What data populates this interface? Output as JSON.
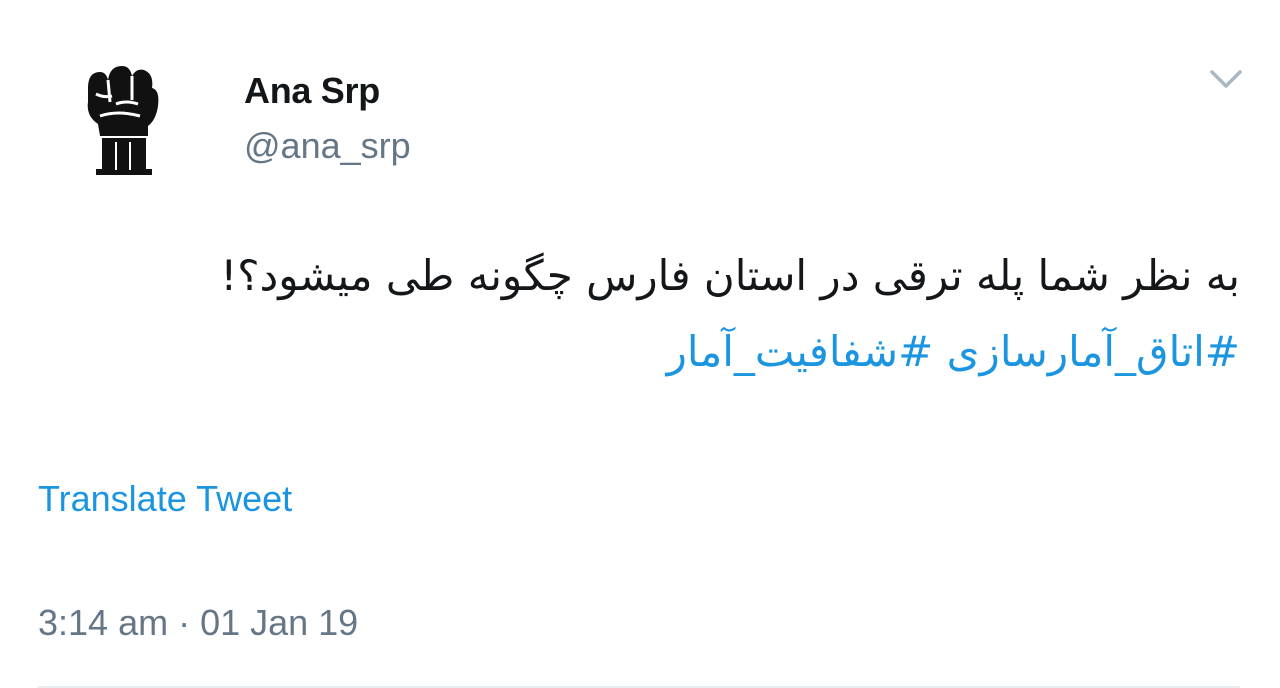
{
  "author": {
    "display_name": "Ana Srp",
    "handle": "@ana_srp",
    "avatar_icon": "raised-fist-icon"
  },
  "menu": {
    "icon": "chevron-down-icon"
  },
  "tweet": {
    "text": "به نظر شما پله ترقی در استان فارس چگونه طی میشود؟!",
    "hashtags": [
      "#اتاق_آمارسازی",
      "#شفافیت_آمار"
    ]
  },
  "actions": {
    "translate_label": "Translate Tweet"
  },
  "meta": {
    "timestamp": "3:14 am · 01 Jan 19"
  },
  "colors": {
    "link": "#1b95e0",
    "secondary_text": "#657786",
    "primary_text": "#14171a",
    "divider": "#e6ecf0",
    "caret": "#aab8c2"
  }
}
